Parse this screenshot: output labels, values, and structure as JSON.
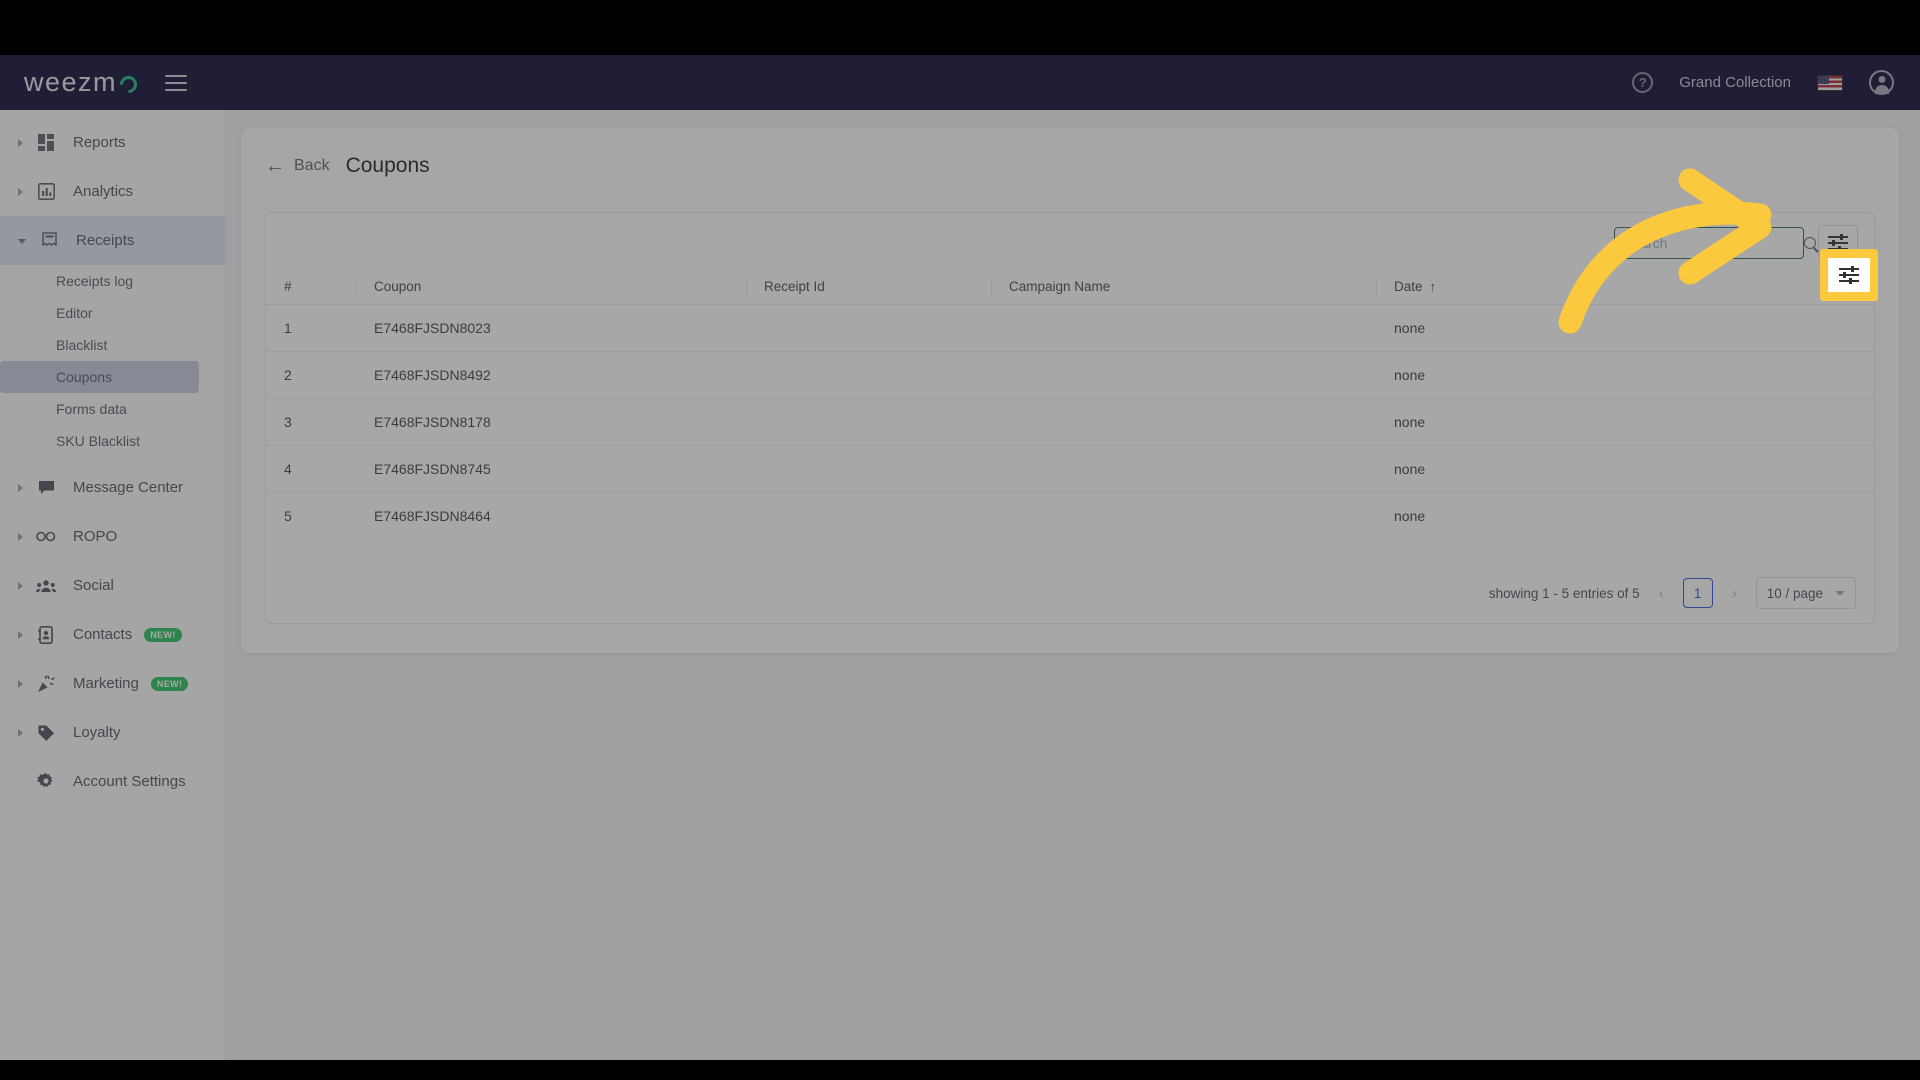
{
  "topbar": {
    "logo_text": "weezm",
    "logo_mark": "o-circle-icon",
    "menu_icon": "hamburger-icon",
    "help_icon": "help-icon",
    "help_glyph": "?",
    "account_name": "Grand Collection",
    "flag_icon": "us-flag-icon",
    "avatar_icon": "account-avatar-icon"
  },
  "sidebar": {
    "items": [
      {
        "label": "Reports",
        "icon": "reports-grid-icon",
        "expanded": false
      },
      {
        "label": "Analytics",
        "icon": "analytics-chart-icon",
        "expanded": false
      },
      {
        "label": "Receipts",
        "icon": "receipt-icon",
        "expanded": true
      }
    ],
    "receipts_children": [
      {
        "label": "Receipts log",
        "selected": false
      },
      {
        "label": "Editor",
        "selected": false
      },
      {
        "label": "Blacklist",
        "selected": false
      },
      {
        "label": "Coupons",
        "selected": true
      },
      {
        "label": "Forms data",
        "selected": false
      },
      {
        "label": "SKU Blacklist",
        "selected": false
      }
    ],
    "items_lower": [
      {
        "label": "Message Center",
        "icon": "message-bubble-icon",
        "badge": ""
      },
      {
        "label": "ROPO",
        "icon": "infinity-icon",
        "badge": ""
      },
      {
        "label": "Social",
        "icon": "people-group-icon",
        "badge": ""
      },
      {
        "label": "Contacts",
        "icon": "contacts-book-icon",
        "badge": "NEW!"
      },
      {
        "label": "Marketing",
        "icon": "party-popper-icon",
        "badge": "NEW!"
      },
      {
        "label": "Loyalty",
        "icon": "tag-icon",
        "badge": ""
      }
    ],
    "account_settings": {
      "label": "Account Settings",
      "icon": "gear-icon"
    },
    "badge_color": "#21c25c"
  },
  "panel": {
    "back_label": "Back",
    "back_icon": "arrow-left-icon",
    "title": "Coupons"
  },
  "toolbar": {
    "search_placeholder": "Search",
    "search_value": "",
    "search_icon": "magnifier-icon",
    "filter_icon": "sliders-filter-icon",
    "search_border_color": "#2f6b4f",
    "highlight_color": "#fbc93d"
  },
  "table": {
    "columns": [
      "#",
      "Coupon",
      "Receipt Id",
      "Campaign Name",
      "Date"
    ],
    "sort_column": "Date",
    "sort_glyph": "↑",
    "rows": [
      {
        "num": "1",
        "coupon": "E7468FJSDN8023",
        "receipt_id": "",
        "campaign_name": "",
        "date": "none"
      },
      {
        "num": "2",
        "coupon": "E7468FJSDN8492",
        "receipt_id": "",
        "campaign_name": "",
        "date": "none"
      },
      {
        "num": "3",
        "coupon": "E7468FJSDN8178",
        "receipt_id": "",
        "campaign_name": "",
        "date": "none"
      },
      {
        "num": "4",
        "coupon": "E7468FJSDN8745",
        "receipt_id": "",
        "campaign_name": "",
        "date": "none"
      },
      {
        "num": "5",
        "coupon": "E7468FJSDN8464",
        "receipt_id": "",
        "campaign_name": "",
        "date": "none"
      }
    ]
  },
  "pagination": {
    "showing_text": "showing 1 - 5 entries of 5",
    "prev_glyph": "‹",
    "next_glyph": "›",
    "current_page": "1",
    "page_size": "10 / page",
    "active_color": "#2f55d4"
  },
  "annotation": {
    "arrow_color": "#fbc93d",
    "arrow_target": "filter-button"
  }
}
